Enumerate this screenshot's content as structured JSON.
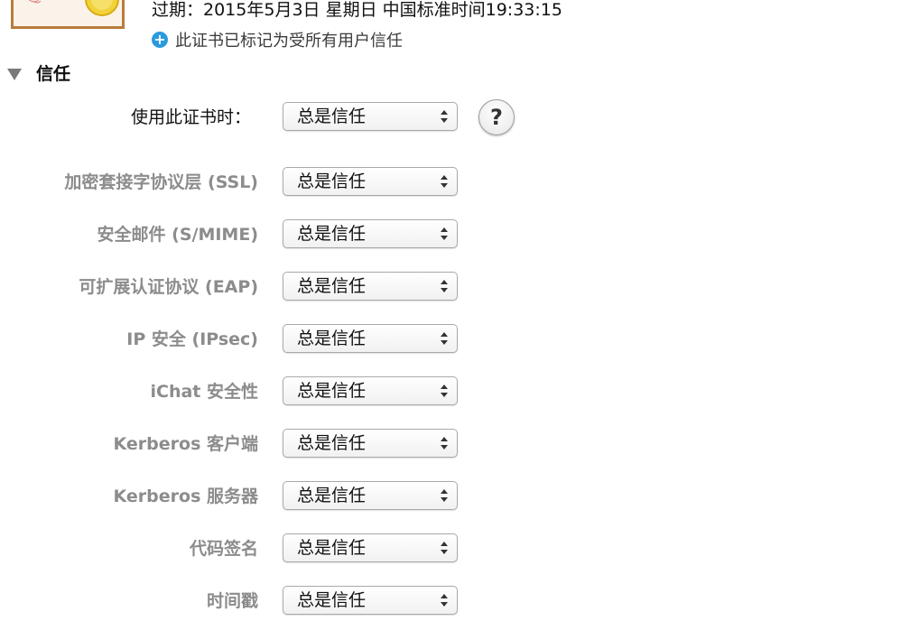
{
  "certificate": {
    "expiry_text": "过期：2015年5月3日 星期日 中国标准时间19:33:15",
    "trust_note": "此证书已标记为受所有用户信任",
    "trust_note_icon": "plus-circle-icon",
    "accent_color": "#2a9ae0"
  },
  "trust_section": {
    "title": "信任",
    "when_using": {
      "label": "使用此证书时：",
      "value": "总是信任"
    },
    "help_label": "?",
    "rows": [
      {
        "label": "加密套接字协议层 (SSL)",
        "value": "总是信任"
      },
      {
        "label": "安全邮件 (S/MIME)",
        "value": "总是信任"
      },
      {
        "label": "可扩展认证协议 (EAP)",
        "value": "总是信任"
      },
      {
        "label": "IP 安全 (IPsec)",
        "value": "总是信任"
      },
      {
        "label": "iChat 安全性",
        "value": "总是信任"
      },
      {
        "label": "Kerberos 客户端",
        "value": "总是信任"
      },
      {
        "label": "Kerberos 服务器",
        "value": "总是信任"
      },
      {
        "label": "代码签名",
        "value": "总是信任"
      },
      {
        "label": "时间戳",
        "value": "总是信任"
      }
    ]
  }
}
